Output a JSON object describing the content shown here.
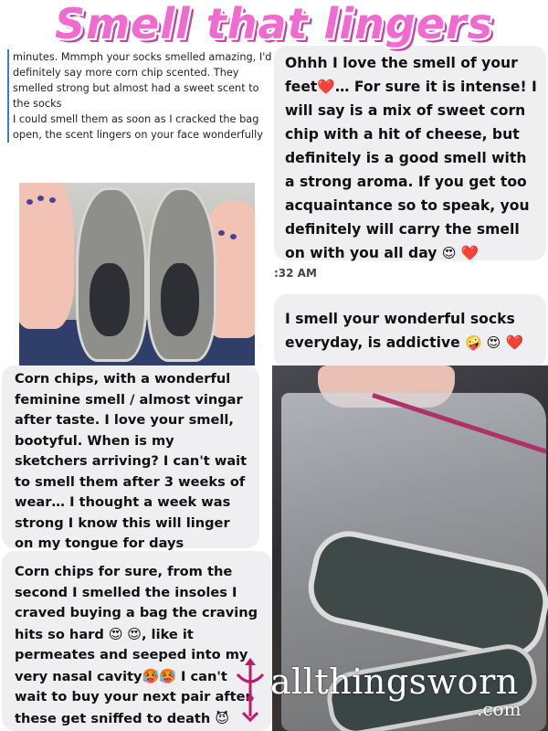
{
  "title": "Smell that lingers",
  "review_plain": {
    "text": "minutes. Mmmph your socks smelled amazing, I'd definitely say more corn chip scented. They smelled strong but almost had a sweet scent to the socks\nI could smell them as soon as I cracked the bag open, the scent lingers on your face wonderfully"
  },
  "bubble_1": {
    "text_a": "Ohhh I love the smell of your feet",
    "text_b": "… For sure it is intense! I will say is a mix of sweet corn chip with a hit of cheese, but definitely is a good smell with a strong aroma. If you get too acquaintance so to speak, you definitely will carry the smell on with you all day ",
    "emoji_end": "😍",
    "heart_mid": "❤️",
    "heart_end": "❤️"
  },
  "timestamp": ":32 AM",
  "bubble_2": {
    "text": "I smell your wonderful socks everyday, is addictive ",
    "emojis": "🤪 😍",
    "heart": "❤️"
  },
  "bubble_3": {
    "text": "Corn chips, with a wonderful feminine smell / almost vingar after taste. I love your smell, bootyful. When is my sketchers arriving? I can't wait to smell them after 3 weeks of wear… I thought a week was strong I know this will linger on my tongue for days"
  },
  "bubble_4": {
    "text_a": "Corn chips for sure, from the second I smelled the insoles I craved buying a bag the craving hits so hard ",
    "emojis_a": "😍 😍",
    "text_b": ", like it permeates and seeped into my very nasal cavity",
    "emojis_b": "🥵🥵",
    "text_c": " I can't wait to buy your next pair after these get sniffed to death ",
    "emojis_c": "😈"
  },
  "watermark": {
    "brand": "allthingsworn",
    "suffix": ".com"
  },
  "colors": {
    "title_pink": "#f06ad0",
    "title_shadow": "#c13fa6",
    "bubble_bg": "#efeff2",
    "heart": "#e01c2a"
  }
}
